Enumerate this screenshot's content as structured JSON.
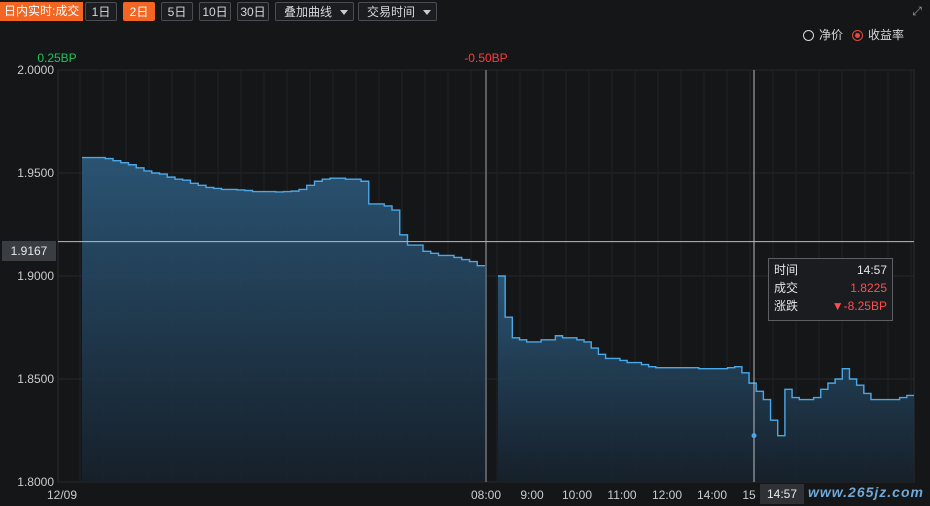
{
  "toolbar": {
    "mode_label": "日内实时:成交",
    "periods": [
      "1日",
      "2日",
      "5日",
      "10日",
      "30日"
    ],
    "active_period": "2日",
    "overlay_label": "叠加曲线",
    "time_label": "交易时间"
  },
  "options": {
    "net_price_label": "净价",
    "yield_label": "收益率",
    "selected": "收益率"
  },
  "colors": {
    "accent": "#f26522",
    "line": "#4aa8e8",
    "up": "#21c25b",
    "down": "#ff3b3b"
  },
  "chart_data": {
    "type": "area",
    "ylim": [
      1.8,
      2.0
    ],
    "yticks": [
      "2.0000",
      "1.9500",
      "1.9000",
      "1.8500",
      "1.8000"
    ],
    "ytick_values": [
      2.0,
      1.95,
      1.9,
      1.85,
      1.8
    ],
    "day_labels": [
      "12/09"
    ],
    "session_changes": [
      "0.25BP",
      "-0.50BP"
    ],
    "xticks": [
      "08:00",
      "9:00",
      "10:00",
      "11:00",
      "12:00",
      "14:00",
      "15"
    ],
    "series": [
      {
        "values_day1": [
          1.9575,
          1.9575,
          1.9575,
          1.957,
          1.956,
          1.955,
          1.954,
          1.9525,
          1.951,
          1.95,
          1.9495,
          1.948,
          1.947,
          1.9465,
          1.945,
          1.944,
          1.943,
          1.9425,
          1.942,
          1.942,
          1.9418,
          1.9415,
          1.941,
          1.941,
          1.941,
          1.9408,
          1.941,
          1.9412,
          1.942,
          1.944,
          1.946,
          1.947,
          1.9475,
          1.9475,
          1.947,
          1.947,
          1.946,
          1.935,
          1.935,
          1.934,
          1.932,
          1.92,
          1.915,
          1.915,
          1.912,
          1.911,
          1.91,
          1.91,
          1.909,
          1.908,
          1.907,
          1.905,
          1.905
        ],
        "values_day2": [
          1.9,
          1.88,
          1.87,
          1.869,
          1.868,
          1.868,
          1.869,
          1.869,
          1.871,
          1.87,
          1.87,
          1.869,
          1.868,
          1.865,
          1.862,
          1.86,
          1.86,
          1.859,
          1.858,
          1.858,
          1.857,
          1.856,
          1.8555,
          1.8555,
          1.8555,
          1.8555,
          1.8555,
          1.8555,
          1.855,
          1.855,
          1.855,
          1.855,
          1.8555,
          1.856,
          1.853,
          1.848,
          1.844,
          1.84,
          1.83,
          1.8225,
          1.845,
          1.841,
          1.84,
          1.84,
          1.841,
          1.845,
          1.848,
          1.85,
          1.855,
          1.85,
          1.847,
          1.843,
          1.84,
          1.84,
          1.84,
          1.84,
          1.841,
          1.842,
          1.842
        ]
      }
    ],
    "crosshair": {
      "y_value": "1.9167",
      "x_time": "14:57"
    },
    "tooltip": {
      "time_label": "时间",
      "time_value": "14:57",
      "deal_label": "成交",
      "deal_value": "1.8225",
      "change_label": "涨跌",
      "change_value": "▼-8.25BP"
    }
  },
  "watermark": "www.265jz.com"
}
